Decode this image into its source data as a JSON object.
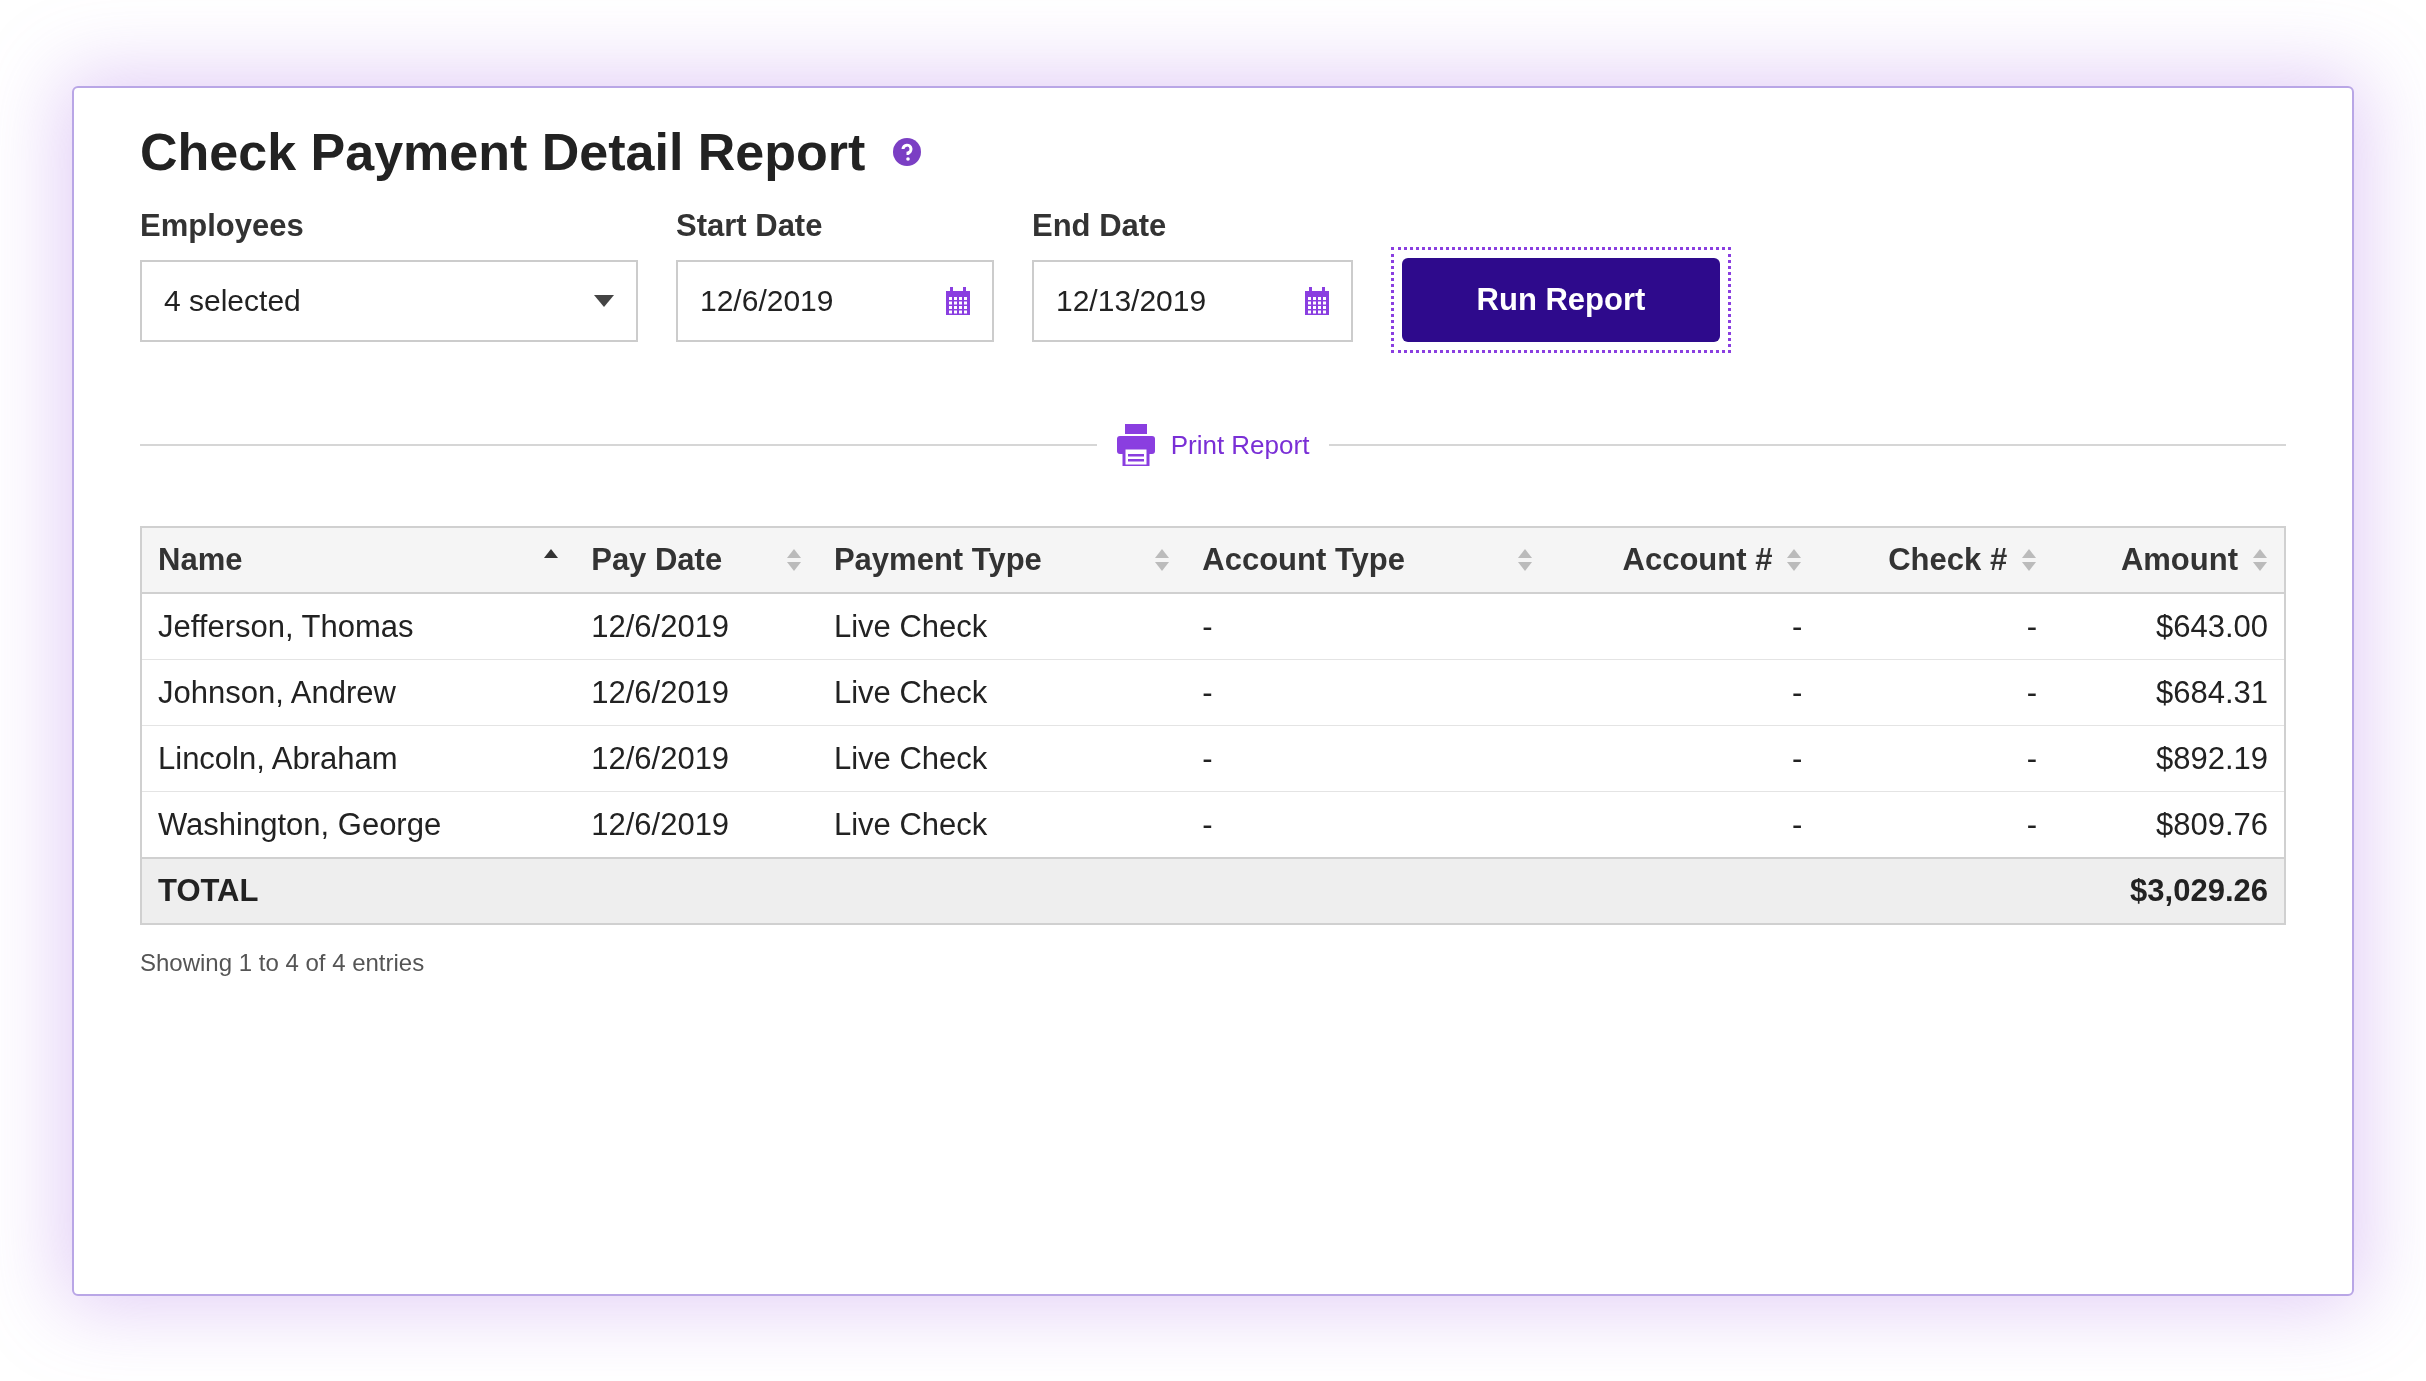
{
  "title": "Check Payment Detail Report",
  "filters": {
    "employees": {
      "label": "Employees",
      "value": "4 selected"
    },
    "start_date": {
      "label": "Start Date",
      "value": "12/6/2019"
    },
    "end_date": {
      "label": "End Date",
      "value": "12/13/2019"
    },
    "run_button": "Run Report"
  },
  "print_link": "Print Report",
  "table": {
    "columns": [
      {
        "label": "Name",
        "sorted": true,
        "numeric": false
      },
      {
        "label": "Pay Date",
        "sorted": false,
        "numeric": false
      },
      {
        "label": "Payment Type",
        "sorted": false,
        "numeric": false
      },
      {
        "label": "Account Type",
        "sorted": false,
        "numeric": false
      },
      {
        "label": "Account #",
        "sorted": false,
        "numeric": true
      },
      {
        "label": "Check #",
        "sorted": false,
        "numeric": true
      },
      {
        "label": "Amount",
        "sorted": false,
        "numeric": true
      }
    ],
    "rows": [
      [
        "Jefferson, Thomas",
        "12/6/2019",
        "Live Check",
        "-",
        "-",
        "-",
        "$643.00"
      ],
      [
        "Johnson, Andrew",
        "12/6/2019",
        "Live Check",
        "-",
        "-",
        "-",
        "$684.31"
      ],
      [
        "Lincoln, Abraham",
        "12/6/2019",
        "Live Check",
        "-",
        "-",
        "-",
        "$892.19"
      ],
      [
        "Washington, George",
        "12/6/2019",
        "Live Check",
        "-",
        "-",
        "-",
        "$809.76"
      ]
    ],
    "total": {
      "label": "TOTAL",
      "amount": "$3,029.26"
    }
  },
  "footer": "Showing 1 to 4 of 4 entries"
}
